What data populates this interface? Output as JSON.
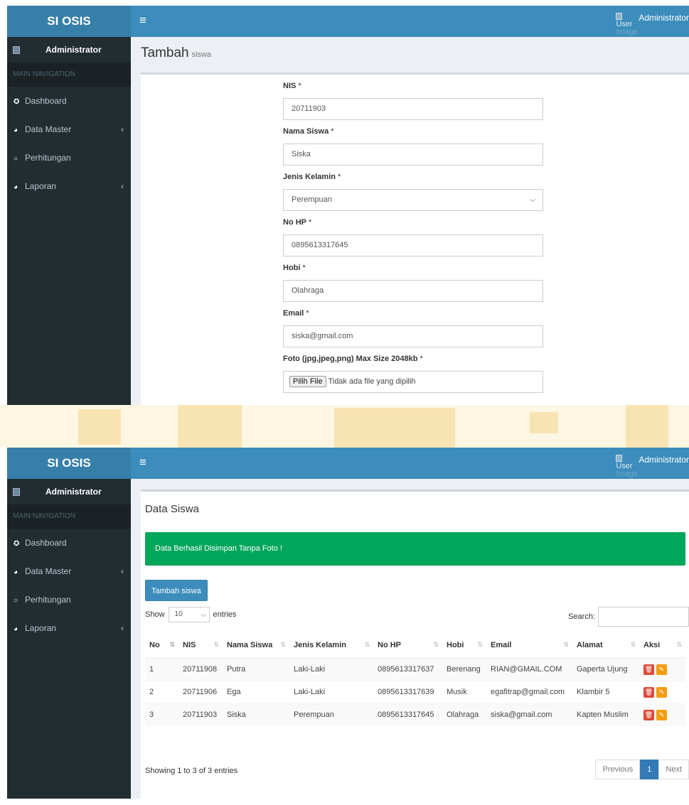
{
  "app": {
    "title": "SI OSIS",
    "user_name": "Administrator",
    "user_image_alt": [
      "User",
      "Image"
    ]
  },
  "sidebar": {
    "user": "Administrator",
    "nav_header": "MAIN NAVIGATION",
    "items": [
      {
        "label": "Dashboard",
        "icon": "dashboard-icon",
        "glyph": "✪",
        "arrow": ""
      },
      {
        "label": "Data Master",
        "icon": "pie-chart-icon",
        "glyph": "◕",
        "arrow": "‹"
      },
      {
        "label": "Perhitungan",
        "icon": "circle-outline-icon",
        "glyph": "○",
        "arrow": ""
      },
      {
        "label": "Laporan",
        "icon": "pie-chart-icon",
        "glyph": "◕",
        "arrow": "‹"
      }
    ]
  },
  "form_page": {
    "title": "Tambah",
    "subtitle": "siswa",
    "fields": [
      {
        "label": "NIS",
        "value": "20711903"
      },
      {
        "label": "Nama Siswa",
        "value": "Siska"
      },
      {
        "label": "Jenis Kelamin",
        "value": "Perempuan",
        "type": "select"
      },
      {
        "label": "No HP",
        "value": "0895613317645"
      },
      {
        "label": "Hobi",
        "value": "Olahraga"
      },
      {
        "label": "Email",
        "value": "siska@gmail.com"
      }
    ],
    "file_field": {
      "label": "Foto (jpg,jpeg,png) Max Size 2048kb",
      "button": "Pilih File",
      "status": "Tidak ada file yang dipilih"
    }
  },
  "list_page": {
    "title": "Data Siswa",
    "alert": "Data Berhasil Disimpan Tanpa Foto !",
    "add_button": "Tambah siswa",
    "show_label": "Show",
    "entries_value": "10",
    "entries_label": "entries",
    "search_label": "Search:",
    "columns": [
      "No",
      "NIS",
      "Nama Siswa",
      "Jenis Kelamin",
      "No HP",
      "Hobi",
      "Email",
      "Alamat",
      "Aksi"
    ],
    "rows": [
      [
        "1",
        "20711908",
        "Putra",
        "Laki-Laki",
        "0895613317637",
        "Berenang",
        "RIAN@GMAIL.COM",
        "Gaperta Ujung"
      ],
      [
        "2",
        "20711906",
        "Ega",
        "Laki-Laki",
        "0895613317639",
        "Musik",
        "egafitrap@gmail.com",
        "Klambir 5"
      ],
      [
        "3",
        "20711903",
        "Siska",
        "Perempuan",
        "0895613317645",
        "Olahraga",
        "siska@gmail.com",
        "Kapten Muslim"
      ]
    ],
    "info": "Showing 1 to 3 of 3 entries",
    "pagination": {
      "previous": "Previous",
      "current": "1",
      "next": "Next"
    }
  },
  "colors": {
    "header": "#3c8dbc",
    "logo": "#367fa9",
    "sidebar": "#222d32",
    "success": "#00a65a",
    "danger": "#dd4b39",
    "warning": "#f39c12"
  }
}
